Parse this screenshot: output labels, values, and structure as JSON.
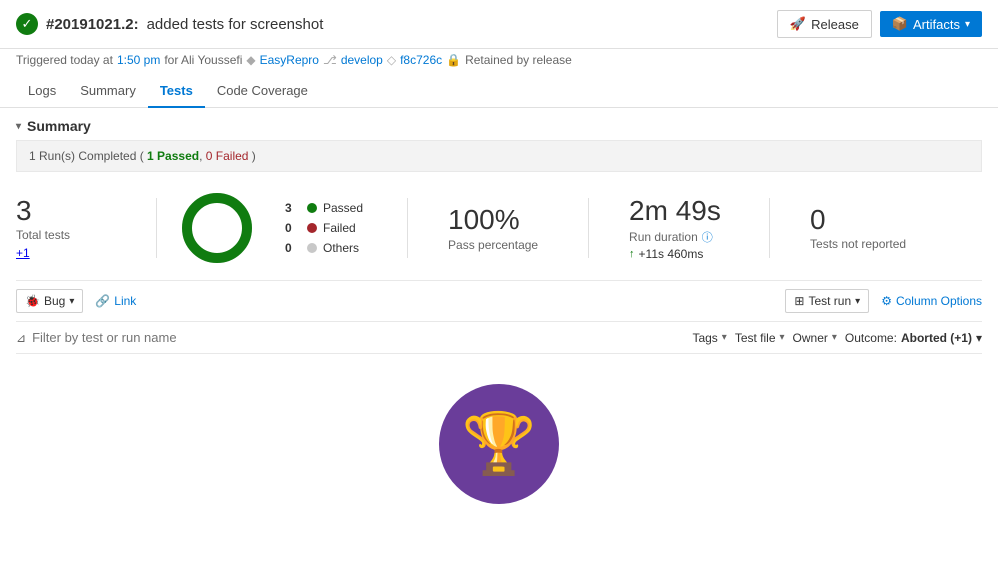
{
  "header": {
    "build_id": "#20191021.2:",
    "build_desc": "added tests for screenshot",
    "success_icon": "✓",
    "trigger_text": "Triggered today at",
    "trigger_time": "1:50 pm",
    "trigger_by": "for Ali Youssefi",
    "repo": "EasyRepro",
    "branch": "develop",
    "commit": "f8c726c",
    "retained": "Retained by release",
    "release_label": "Release",
    "artifacts_label": "Artifacts"
  },
  "nav": {
    "tabs": [
      {
        "label": "Logs",
        "active": false
      },
      {
        "label": "Summary",
        "active": false
      },
      {
        "label": "Tests",
        "active": true
      },
      {
        "label": "Code Coverage",
        "active": false
      }
    ]
  },
  "summary": {
    "section_label": "Summary",
    "status_bar": "1 Run(s) Completed ( 1 Passed, 0 Failed )",
    "total_tests_count": "3",
    "total_tests_label": "Total tests",
    "plus_link": "+1",
    "chart": {
      "passed": 3,
      "failed": 0,
      "others": 0,
      "total": 3
    },
    "legend": [
      {
        "label": "Passed",
        "count": "3",
        "color": "#107c10"
      },
      {
        "label": "Failed",
        "count": "0",
        "color": "#a4262c"
      },
      {
        "label": "Others",
        "count": "0",
        "color": "#c8c8c8"
      }
    ],
    "pass_percentage": "100%",
    "pass_percentage_label": "Pass percentage",
    "run_duration": "2m 49s",
    "run_duration_label": "Run duration",
    "run_delta": "+11s 460ms",
    "tests_not_reported": "0",
    "tests_not_reported_label": "Tests not reported"
  },
  "toolbar": {
    "bug_label": "Bug",
    "link_label": "Link",
    "test_run_label": "Test run",
    "column_options_label": "Column Options"
  },
  "filter": {
    "placeholder": "Filter by test or run name",
    "tags_label": "Tags",
    "test_file_label": "Test file",
    "owner_label": "Owner",
    "outcome_label": "Outcome:",
    "outcome_value": "Aborted (+1)"
  },
  "empty_state": {
    "trophy_emoji": "🏆"
  }
}
